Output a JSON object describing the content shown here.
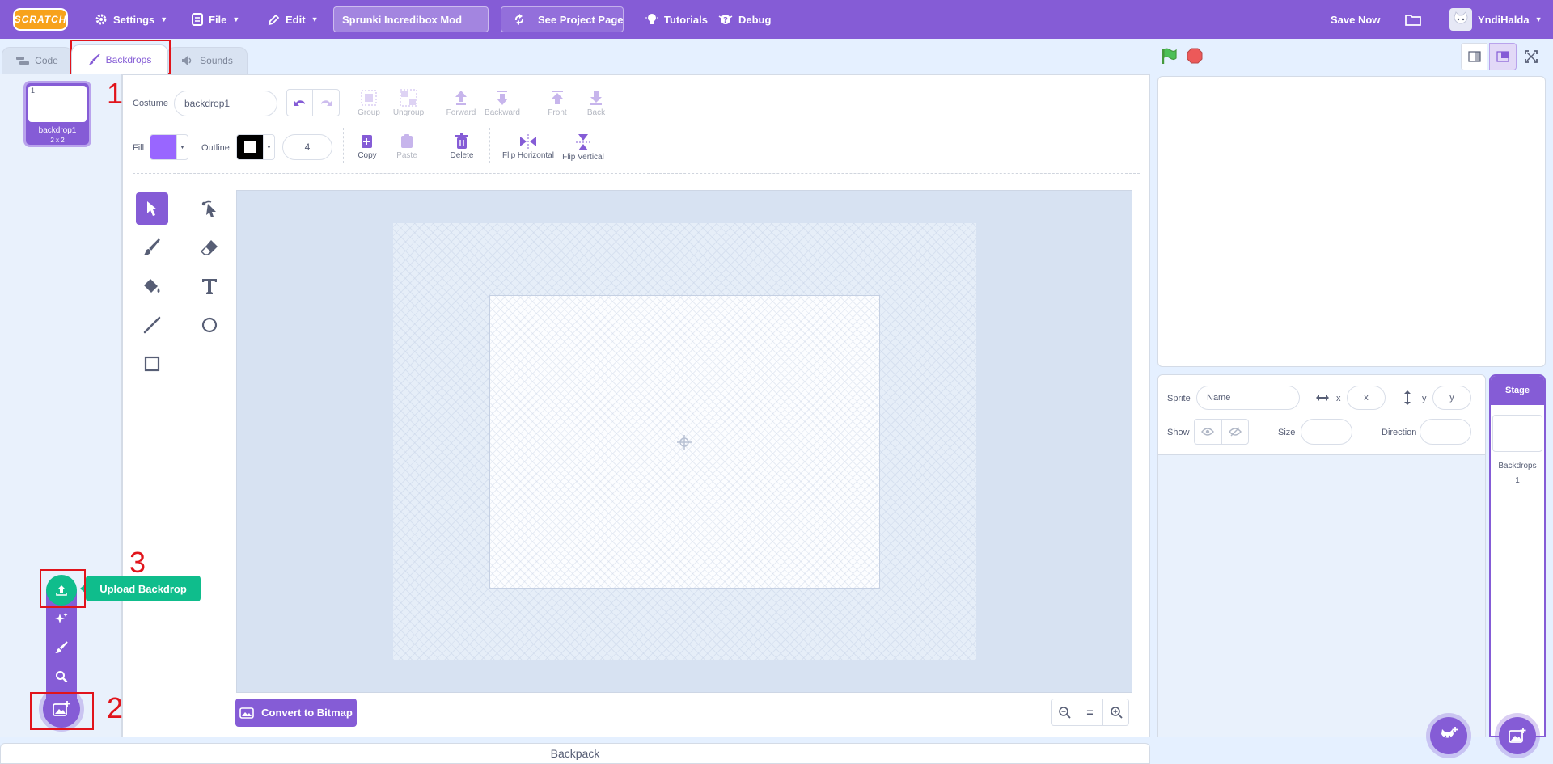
{
  "menubar": {
    "logo": "SCRATCH",
    "settings": "Settings",
    "file": "File",
    "edit": "Edit",
    "project_title": "Sprunki Incredibox Mod",
    "see_project_page": "See Project Page",
    "tutorials": "Tutorials",
    "debug": "Debug",
    "save_now": "Save Now",
    "username": "YndiHalda"
  },
  "tabs": {
    "code": "Code",
    "backdrops": "Backdrops",
    "sounds": "Sounds"
  },
  "costume_list": [
    {
      "index": "1",
      "name": "backdrop1",
      "size": "2 x 2"
    }
  ],
  "paint_editor": {
    "costume_label": "Costume",
    "costume_name": "backdrop1",
    "group": "Group",
    "ungroup": "Ungroup",
    "forward": "Forward",
    "backward": "Backward",
    "front": "Front",
    "back": "Back",
    "fill_label": "Fill",
    "fill_color": "#9966ff",
    "outline_label": "Outline",
    "outline_color": "#000000",
    "outline_width": "4",
    "copy": "Copy",
    "paste": "Paste",
    "delete": "Delete",
    "flip_horizontal": "Flip Horizontal",
    "flip_vertical": "Flip Vertical",
    "convert_button": "Convert to Bitmap",
    "zoom_reset": "="
  },
  "add_menu": {
    "tooltip": "Upload Backdrop"
  },
  "sprite_info": {
    "sprite_label": "Sprite",
    "name_placeholder": "Name",
    "x_label": "x",
    "x_placeholder": "x",
    "y_label": "y",
    "y_placeholder": "y",
    "show_label": "Show",
    "size_label": "Size",
    "direction_label": "Direction"
  },
  "stage_pane": {
    "title": "Stage",
    "backdrops_label": "Backdrops",
    "backdrops_count": "1"
  },
  "backpack": "Backpack",
  "annotations": [
    "1",
    "2",
    "3"
  ]
}
